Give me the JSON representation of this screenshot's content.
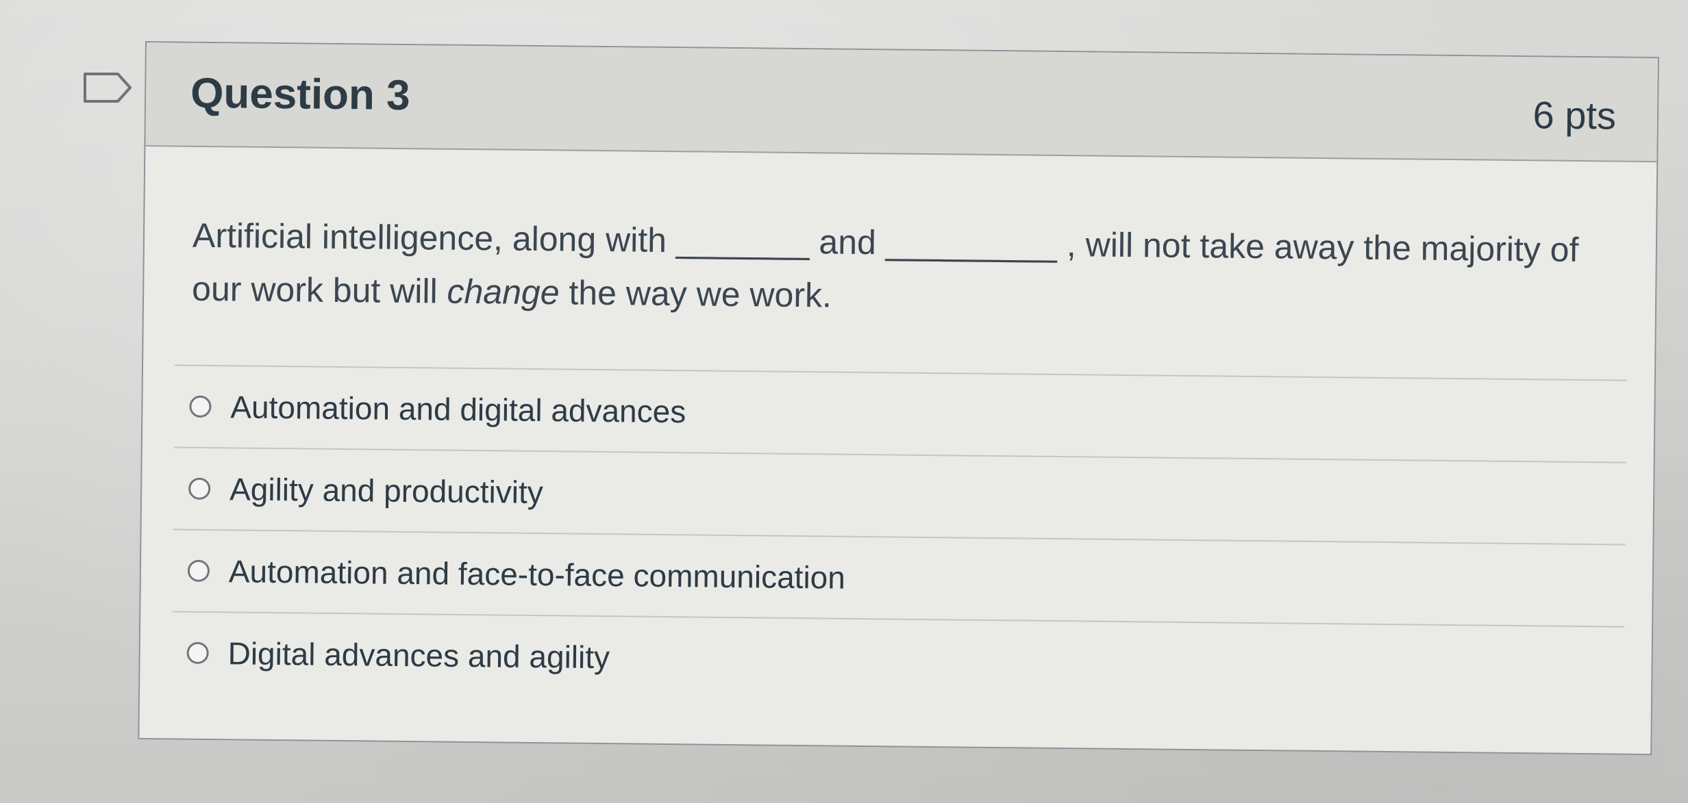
{
  "question": {
    "title": "Question 3",
    "points": "6 pts",
    "text_part1": "Artificial intelligence, along with ",
    "blank1": "_______",
    "text_part2": " and ",
    "blank2": "_________",
    "text_part3": " , will not take away the majority of our work but will ",
    "emphasis": "change",
    "text_part4": " the way we work."
  },
  "answers": [
    {
      "label": "Automation and digital advances",
      "selected": false
    },
    {
      "label": "Agility and productivity",
      "selected": false
    },
    {
      "label": "Automation and face-to-face communication",
      "selected": false
    },
    {
      "label": "Digital advances and agility",
      "selected": false
    }
  ],
  "icons": {
    "flag": "flag-bookmark-icon",
    "radio": "radio-circle-icon"
  },
  "colors": {
    "text": "#2d3b45",
    "header_bg": "#d7d7d4",
    "card_bg": "#eaeae7",
    "border": "#8d9399"
  }
}
